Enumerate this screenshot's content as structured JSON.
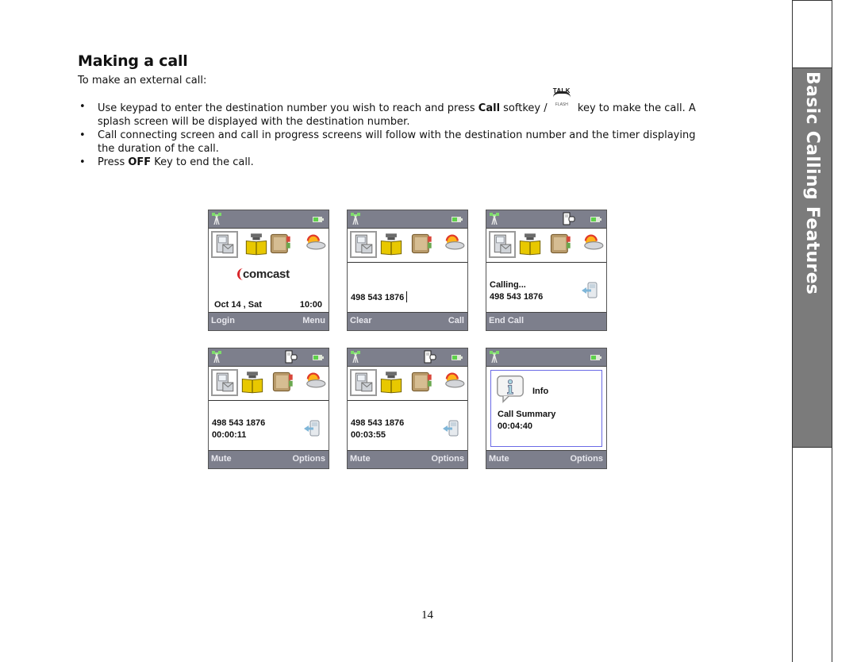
{
  "page": {
    "heading": "Making a call",
    "intro": "To make an external call:",
    "bullets": [
      {
        "pre": "Use keypad to enter the destination number you wish to reach and press ",
        "bold": "Call",
        "post1": " softkey / ",
        "post2": " key to make the call. A splash screen will be displayed with the destination number."
      },
      {
        "text": "Call connecting screen and call in progress screens will follow with the destination number and the timer displaying the duration of the call."
      },
      {
        "pre": "Press ",
        "bold": "OFF",
        "post": " Key to end the call."
      }
    ],
    "bullet_glyph": "•",
    "talk_key": {
      "top": "TALK",
      "bottom": "FLASH",
      "icon": "talk-flash-key-icon"
    },
    "page_number": "14",
    "side_tab": "Basic Calling Features"
  },
  "colors": {
    "bar": "#7d7f8c",
    "side_tab": "#7b7b7b",
    "info_border": "#6a6ae6"
  },
  "screens": [
    {
      "name": "idle",
      "logo": "comcast",
      "date": "Oct 14 , Sat",
      "time": "10:00",
      "soft_left": "Login",
      "soft_right": "Menu"
    },
    {
      "name": "dialing",
      "number": "498 543 1876",
      "soft_left": "Clear",
      "soft_right": "Call"
    },
    {
      "name": "calling",
      "status": "Calling...",
      "number": "498 543 1876",
      "soft_left": "End Call",
      "soft_right": ""
    },
    {
      "name": "in-call-1",
      "number": "498 543 1876",
      "timer": "00:00:11",
      "soft_left": "Mute",
      "soft_right": "Options"
    },
    {
      "name": "in-call-2",
      "number": "498 543 1876",
      "timer": "00:03:55",
      "soft_left": "Mute",
      "soft_right": "Options"
    },
    {
      "name": "call-summary",
      "info_title": "Info",
      "summary_label": "Call Summary",
      "duration": "00:04:40",
      "soft_left": "Mute",
      "soft_right": "Options"
    }
  ],
  "icons": [
    "antenna-icon",
    "battery-icon",
    "messages-icon",
    "phonebook-icon",
    "notes-icon",
    "weather-icon",
    "call-indicator-icon",
    "transfer-icon",
    "info-icon"
  ]
}
